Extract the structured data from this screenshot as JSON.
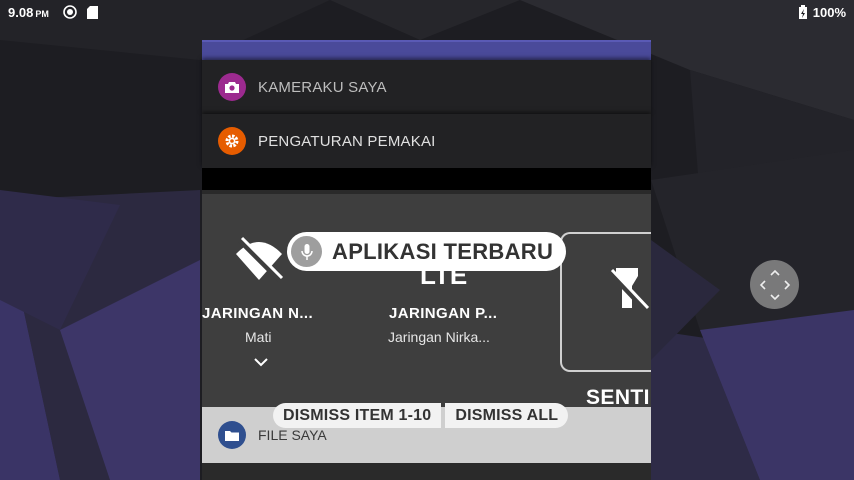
{
  "status_bar": {
    "time": "9.08",
    "ampm": "PM",
    "battery": "100%",
    "icons": [
      "sync-icon",
      "sdcard-icon",
      "battery-icon"
    ]
  },
  "recents": {
    "title_chip": "APLIKASI TERBARU",
    "cards": [
      {
        "label": "KAMERAKU SAYA",
        "icon": "camera-icon",
        "icon_color": "#9c2a8f"
      },
      {
        "label": "PENGATURAN PEMAKAI",
        "icon": "settings-gear-icon",
        "icon_color": "#e65c00"
      }
    ],
    "quick_settings": {
      "wifi_label": "JARINGAN N...",
      "wifi_sub": "Mati",
      "mobile_label": "JARINGAN P...",
      "mobile_sub": "Jaringan Nirka...",
      "mobile_type": "LTE",
      "torch_label": "SENTI"
    },
    "file_card": {
      "label": "FILE SAYA",
      "icon": "folder-icon",
      "icon_color": "#2f4f8f"
    },
    "dismiss_items": "DISMISS ITEM 1-10",
    "dismiss_all": "DISMISS ALL"
  },
  "colors": {
    "accent_strip": "#4a4a9a",
    "card_bg": "#222224",
    "qs_bg": "#3e3e3e"
  }
}
